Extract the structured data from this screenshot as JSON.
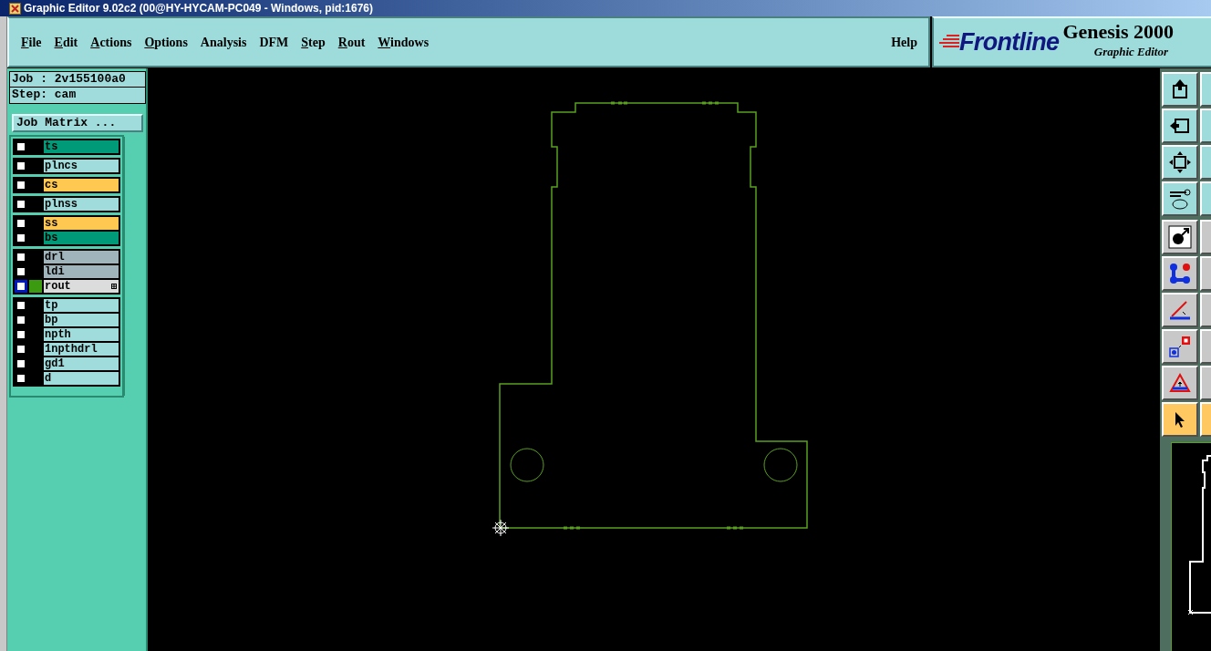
{
  "window": {
    "title": "Graphic Editor 9.02c2 (00@HY-HYCAM-PC049 - Windows, pid:1676)"
  },
  "menu": [
    {
      "label": "File",
      "mnemonic": true
    },
    {
      "label": "Edit",
      "mnemonic": true
    },
    {
      "label": "Actions",
      "mnemonic": true
    },
    {
      "label": "Options",
      "mnemonic": true
    },
    {
      "label": "Analysis",
      "mnemonic": false
    },
    {
      "label": "DFM",
      "mnemonic": false
    },
    {
      "label": "Step",
      "mnemonic": true
    },
    {
      "label": "Rout",
      "mnemonic": true
    },
    {
      "label": "Windows",
      "mnemonic": true
    }
  ],
  "help": {
    "label": "Help"
  },
  "logo": {
    "brand": "Frontline",
    "product": "Genesis 2000",
    "subtitle": "Graphic Editor"
  },
  "job": {
    "job_line": "Job : 2v155100a0",
    "step_line": "Step: cam",
    "matrix_button": "Job Matrix ..."
  },
  "layer_groups": [
    {
      "layers": [
        {
          "name": "ts",
          "color": "#009a78",
          "checked": false,
          "work": false
        }
      ]
    },
    {
      "layers": [
        {
          "name": "plncs",
          "color": "#a0dcdc",
          "checked": false,
          "work": false
        }
      ]
    },
    {
      "layers": [
        {
          "name": "cs",
          "color": "#ffc850",
          "checked": false,
          "work": false
        }
      ]
    },
    {
      "layers": [
        {
          "name": "plnss",
          "color": "#a0dcdc",
          "checked": false,
          "work": false
        }
      ]
    },
    {
      "layers": [
        {
          "name": "ss",
          "color": "#ffc850",
          "checked": false,
          "work": false
        },
        {
          "name": "bs",
          "color": "#009a78",
          "checked": false,
          "work": false
        }
      ]
    },
    {
      "layers": [
        {
          "name": "drl",
          "color": "#a0b4bc",
          "checked": false,
          "work": false
        },
        {
          "name": "ldi",
          "color": "#a0b4bc",
          "checked": false,
          "work": false
        },
        {
          "name": "rout",
          "color": "#dcdcdc",
          "checked": false,
          "work": true
        }
      ]
    },
    {
      "layers": [
        {
          "name": "tp",
          "color": "#a0dcdc",
          "checked": false,
          "work": false
        },
        {
          "name": "bp",
          "color": "#a0dcdc",
          "checked": false,
          "work": false
        },
        {
          "name": "npth",
          "color": "#a0dcdc",
          "checked": false,
          "work": false
        },
        {
          "name": "1npthdrl",
          "color": "#a0dcdc",
          "checked": false,
          "work": false
        },
        {
          "name": "gd1",
          "color": "#a0dcdc",
          "checked": false,
          "work": false
        },
        {
          "name": "d",
          "color": "#a0dcdc",
          "checked": false,
          "work": false
        }
      ]
    }
  ],
  "tools": [
    {
      "selected": false
    },
    {
      "selected": false
    },
    {
      "selected": false
    },
    {
      "selected": false
    },
    {
      "selected": false
    },
    {
      "selected": false
    },
    {
      "selected": false
    },
    {
      "selected": false
    },
    {
      "selected": false
    },
    {
      "selected": true
    }
  ]
}
